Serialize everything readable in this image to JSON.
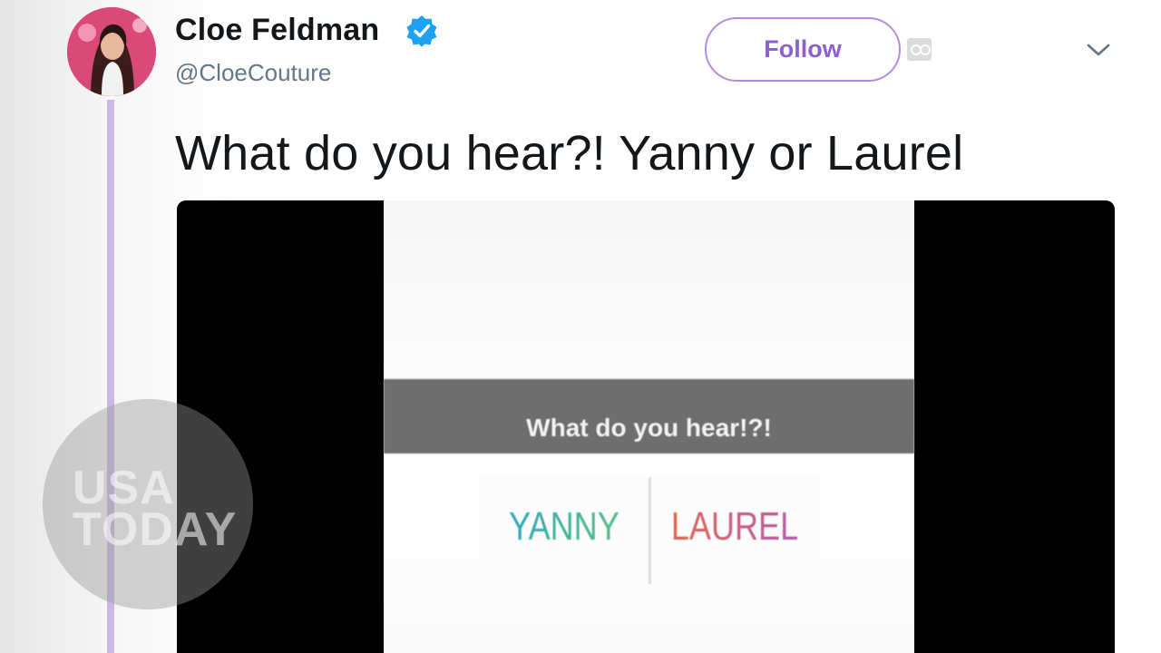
{
  "tweet": {
    "author": {
      "display_name": "Cloe Feldman",
      "handle": "@CloeCouture",
      "verified": true,
      "avatar_icon": "profile-photo"
    },
    "follow_label": "Follow",
    "text": "What do you hear?! Yanny or Laurel",
    "media": {
      "type": "video",
      "banner_text": "What do you hear!?!",
      "options": [
        "YANNY",
        "LAUREL"
      ]
    }
  },
  "icons": {
    "verified": "verified-badge-icon",
    "more": "chevron-down-icon",
    "settings": "glasses-settings-icon"
  },
  "watermark": {
    "line1": "USA",
    "line2": "TODAY"
  },
  "colors": {
    "accent": "#8d5fcf",
    "thread_line": "#cbb8e3",
    "verified": "#1da1f2",
    "yanny": "#2aa6c9",
    "laurel": "#e0674a"
  }
}
